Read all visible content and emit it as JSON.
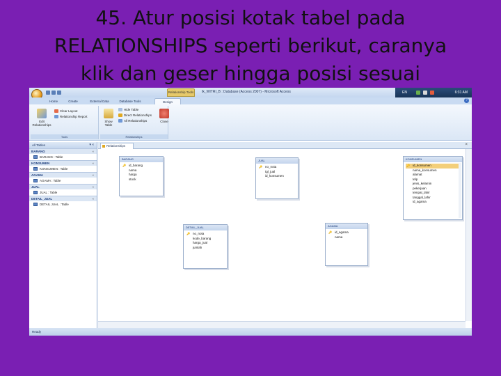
{
  "slide": {
    "title_line1": "45. Atur posisi kotak tabel pada",
    "title_line2": "RELATIONSHIPS seperti berikut, caranya",
    "title_line3": "klik dan geser hingga posisi sesuai"
  },
  "window": {
    "context_tab": "Relationship Tools",
    "title": "tk_WITRI_B : Database (Access 2007) - Microsoft Access",
    "tray_lang": "EN",
    "tray_time": "6:31 AM"
  },
  "ribbon_tabs": [
    "Home",
    "Create",
    "External Data",
    "Database Tools",
    "Design"
  ],
  "ribbon": {
    "edit_relationships": "Edit Relationships",
    "clear_layout": "Clear Layout",
    "relationship_report": "Relationship Report",
    "tools_label": "Tools",
    "show_table": "Show Table",
    "hide_table": "Hide Table",
    "direct_relationships": "Direct Relationships",
    "all_relationships": "All Relationships",
    "relationships_label": "Relationships",
    "close": "Close"
  },
  "nav": {
    "header": "All Tables",
    "groups": [
      {
        "name": "BARANG",
        "item": "BARANG : Table"
      },
      {
        "name": "KONSUMEN",
        "item": "KONSUMEN : Table"
      },
      {
        "name": "AGAMA",
        "item": "AGAMA : Table"
      },
      {
        "name": "JUAL",
        "item": "JUAL : Table"
      },
      {
        "name": "DETAIL_JUAL",
        "item": "DETAIL JUAL : Table"
      }
    ]
  },
  "doc_tab": "Relationships",
  "tables": {
    "barang": {
      "title": "BARANG",
      "fields": [
        "id_barang",
        "nama",
        "harga",
        "stock"
      ]
    },
    "jual": {
      "title": "JUAL",
      "fields": [
        "no_nota",
        "tgl_jual",
        "id_konsumen"
      ]
    },
    "konsumen": {
      "title": "KONSUMEN",
      "fields": [
        "id_konsumen",
        "nama_konsumen",
        "alamat",
        "telp",
        "jenis_kelamin",
        "pekerjaan",
        "tempat_lahir",
        "tanggal_lahir",
        "id_agama"
      ]
    },
    "detail_jual": {
      "title": "DETAIL_JUAL",
      "fields": [
        "no_nota",
        "kode_barang",
        "harga_jual",
        "jumlah"
      ]
    },
    "agama": {
      "title": "AGAMA",
      "fields": [
        "id_agama",
        "nama"
      ]
    }
  },
  "status": "Ready",
  "colors": {
    "slide_bg": "#7a1fb3",
    "selected_field": "#f3cf7a"
  }
}
